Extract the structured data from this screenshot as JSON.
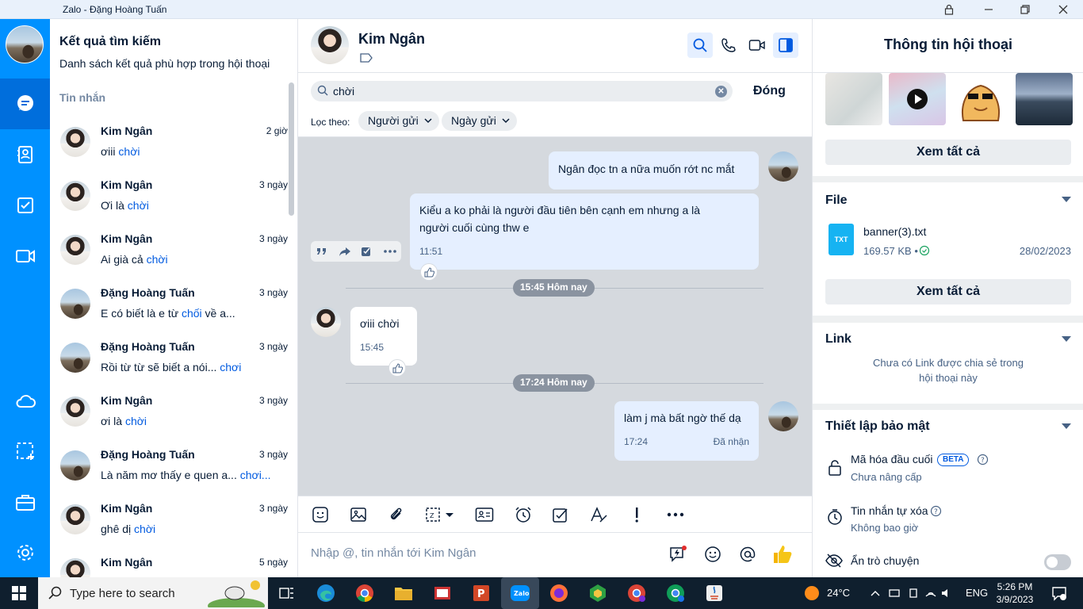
{
  "window": {
    "title": "Zalo - Đặng Hoàng Tuấn"
  },
  "search_panel": {
    "title": "Kết quả tìm kiếm",
    "subtitle": "Danh sách kết quả phù hợp trong hội thoại",
    "section": "Tin nhắn",
    "results": [
      {
        "name": "Kim Ngân",
        "time": "2 giờ",
        "before": "ơiii ",
        "match": "chời",
        "after": ""
      },
      {
        "name": "Kim Ngân",
        "time": "3 ngày",
        "before": "Ơi là ",
        "match": "chời",
        "after": ""
      },
      {
        "name": "Kim Ngân",
        "time": "3 ngày",
        "before": "Ai già cả ",
        "match": "chời",
        "after": ""
      },
      {
        "name": "Đặng Hoàng Tuấn",
        "time": "3 ngày",
        "before": "E có biết là e từ ",
        "match": "chối",
        "after": " về a..."
      },
      {
        "name": "Đặng Hoàng Tuấn",
        "time": "3 ngày",
        "before": "Rồi từ từ sẽ biết a nói... ",
        "match": "chơi",
        "after": ""
      },
      {
        "name": "Kim Ngân",
        "time": "3 ngày",
        "before": "ơi là ",
        "match": "chời",
        "after": ""
      },
      {
        "name": "Đặng Hoàng Tuấn",
        "time": "3 ngày",
        "before": "Là năm mơ thấy e quen a... ",
        "match": "chơi...",
        "after": ""
      },
      {
        "name": "Kim Ngân",
        "time": "3 ngày",
        "before": "ghê dị ",
        "match": "chời",
        "after": ""
      },
      {
        "name": "Kim Ngân",
        "time": "5 ngày",
        "before": "",
        "match": "",
        "after": ""
      }
    ]
  },
  "chat": {
    "name": "Kim Ngân",
    "search_query": "chời",
    "close_label": "Đóng",
    "filter_label": "Lọc theo:",
    "filter_sender": "Người gửi",
    "filter_date": "Ngày gửi",
    "messages": {
      "m1": "Ngân đọc tn a nữa muốn rớt nc mắt",
      "m2_line1": "Kiểu a ko phải là người đầu tiên bên cạnh em nhưng a là",
      "m2_line2": "người cuối cùng thw e",
      "m2_time": "11:51",
      "divider1": "15:45 Hôm nay",
      "m3": "ơiii chời",
      "m3_time": "15:45",
      "divider2": "17:24 Hôm nay",
      "m4": "làm j mà bất ngờ thế dạ",
      "m4_time": "17:24",
      "m4_status": "Đã nhận"
    },
    "composer_placeholder": "Nhập @, tin nhắn tới Kim Ngân"
  },
  "info_panel": {
    "title": "Thông tin hội thoại",
    "see_all": "Xem tất cả",
    "file_title": "File",
    "file_name": "banner(3).txt",
    "file_ext": "TXT",
    "file_size": "169.57 KB •",
    "file_date": "28/02/2023",
    "link_title": "Link",
    "link_empty_1": "Chưa có Link được chia sẻ trong",
    "link_empty_2": "hội thoại này",
    "security_title": "Thiết lập bảo mật",
    "e2e_label": "Mã hóa đầu cuối",
    "e2e_badge": "BETA",
    "e2e_sub": "Chưa nâng cấp",
    "autodelete_label": "Tin nhắn tự xóa",
    "autodelete_sub": "Không bao giờ",
    "hide_label": "Ẩn trò chuyện"
  },
  "taskbar": {
    "search_placeholder": "Type here to search",
    "temperature": "24°C",
    "language": "ENG",
    "time": "5:26 PM",
    "date": "3/9/2023",
    "zalo_label": "Zalo"
  },
  "colors": {
    "brand": "#0091ff",
    "nav_active": "#006edc",
    "highlight": "#005ae0"
  }
}
